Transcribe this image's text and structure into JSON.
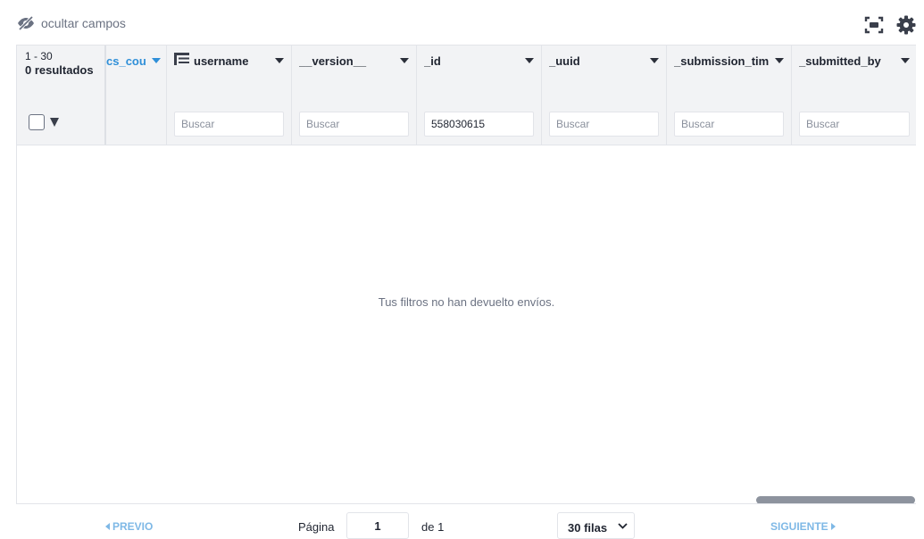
{
  "toolbar": {
    "hide_fields_label": "ocultar campos",
    "icons": [
      "eye-slash-icon",
      "fullscreen-icon",
      "gear-icon"
    ]
  },
  "table": {
    "range_label": "1 - 30",
    "results_label": "0 resultados",
    "columns": [
      {
        "name": "cs_cou",
        "filter_value": "",
        "sorted": true
      },
      {
        "name": "username",
        "filter_value": "",
        "filter_placeholder": "Buscar",
        "icon": "text-field-icon"
      },
      {
        "name": "__version__",
        "filter_value": "",
        "filter_placeholder": "Buscar"
      },
      {
        "name": "_id",
        "filter_value": "558030615",
        "filter_placeholder": "Buscar"
      },
      {
        "name": "_uuid",
        "filter_value": "",
        "filter_placeholder": "Buscar"
      },
      {
        "name": "_submission_tim",
        "filter_value": "",
        "filter_placeholder": "Buscar"
      },
      {
        "name": "_submitted_by",
        "filter_value": "",
        "filter_placeholder": "Buscar"
      }
    ],
    "empty_message": "Tus filtros no han devuelto envíos."
  },
  "pagination": {
    "prev_label": "PREVIO",
    "page_label": "Página",
    "current_page": "1",
    "of_label": "de 1",
    "rows_selected": "30 filas",
    "next_label": "SIGUIENTE"
  },
  "colors": {
    "accent": "#2f8fd8",
    "disabled_link": "#7eb8e6",
    "header_bg": "#f2f3f5",
    "muted_text": "#6b7282"
  }
}
